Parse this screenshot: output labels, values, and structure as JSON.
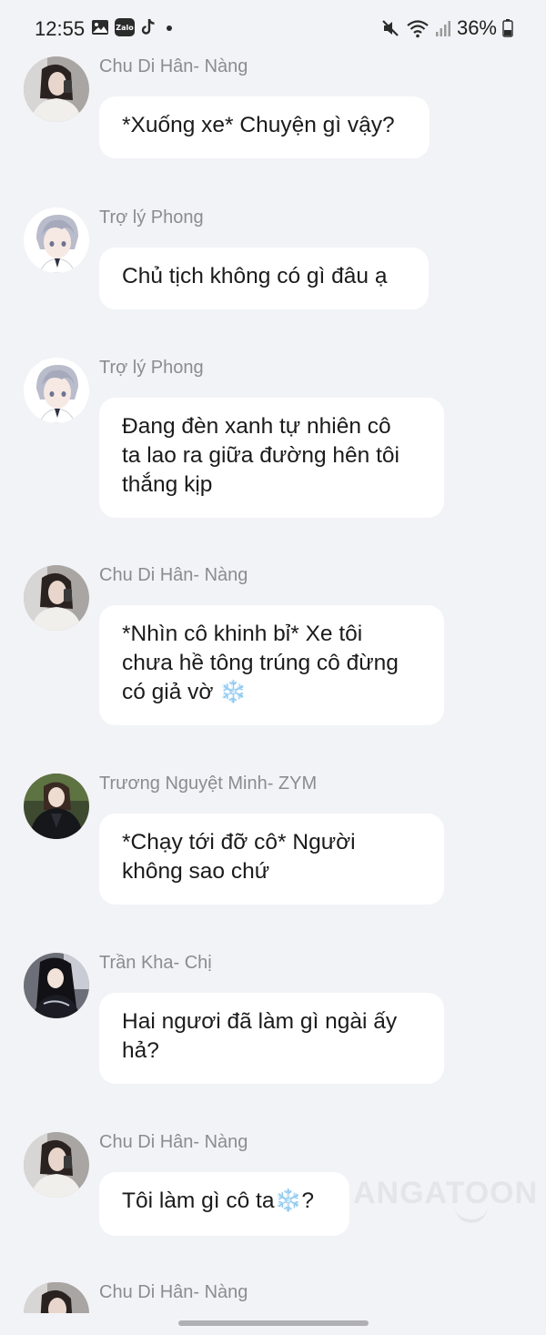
{
  "status_bar": {
    "time": "12:55",
    "left_icons": [
      "image-icon",
      "zalo-icon",
      "tiktok-icon",
      "dot-icon"
    ],
    "zalo_label": "Zalo",
    "battery": "36%",
    "right_icons": [
      "mute-icon",
      "wifi-icon",
      "signal-icon",
      "battery-icon"
    ]
  },
  "messages": [
    {
      "sender": "Chu Di Hân- Nàng",
      "lines": [
        "*Xuống xe* Chuyện gì vậy?"
      ],
      "avatar": "avatar-girl-white-shirt"
    },
    {
      "sender": "Trợ lý Phong",
      "lines": [
        "Chủ tịch không có gì đâu ạ"
      ],
      "avatar": "avatar-anime-silver-hair"
    },
    {
      "sender": "Trợ lý Phong",
      "lines": [
        "Đang đèn xanh tự nhiên cô",
        "ta lao ra giữa đường hên tôi",
        "thắng kịp"
      ],
      "avatar": "avatar-anime-silver-hair"
    },
    {
      "sender": "Chu Di Hân- Nàng",
      "lines": [
        "*Nhìn cô khinh bỉ* Xe tôi",
        "chưa hề tông trúng cô đừng",
        "có giả vờ"
      ],
      "emoji": "❄️",
      "avatar": "avatar-girl-white-shirt"
    },
    {
      "sender": "Trương Nguyệt Minh- ZYM",
      "lines": [
        "*Chạy tới đỡ cô* Người",
        "không sao chứ"
      ],
      "avatar": "avatar-girl-dark-jacket"
    },
    {
      "sender": "Trần Kha- Chị",
      "lines": [
        "Hai ngươi đã làm gì ngài ấy",
        "hả?"
      ],
      "avatar": "avatar-girl-black-hair"
    },
    {
      "sender": "Chu Di Hân- Nàng",
      "lines": [
        "Tôi làm gì cô ta",
        "?"
      ],
      "emoji": "❄️",
      "avatar": "avatar-girl-white-shirt"
    },
    {
      "sender": "Chu Di Hân- Nàng",
      "lines": [],
      "avatar": "avatar-girl-white-shirt"
    }
  ],
  "watermark": "ANGATOON"
}
